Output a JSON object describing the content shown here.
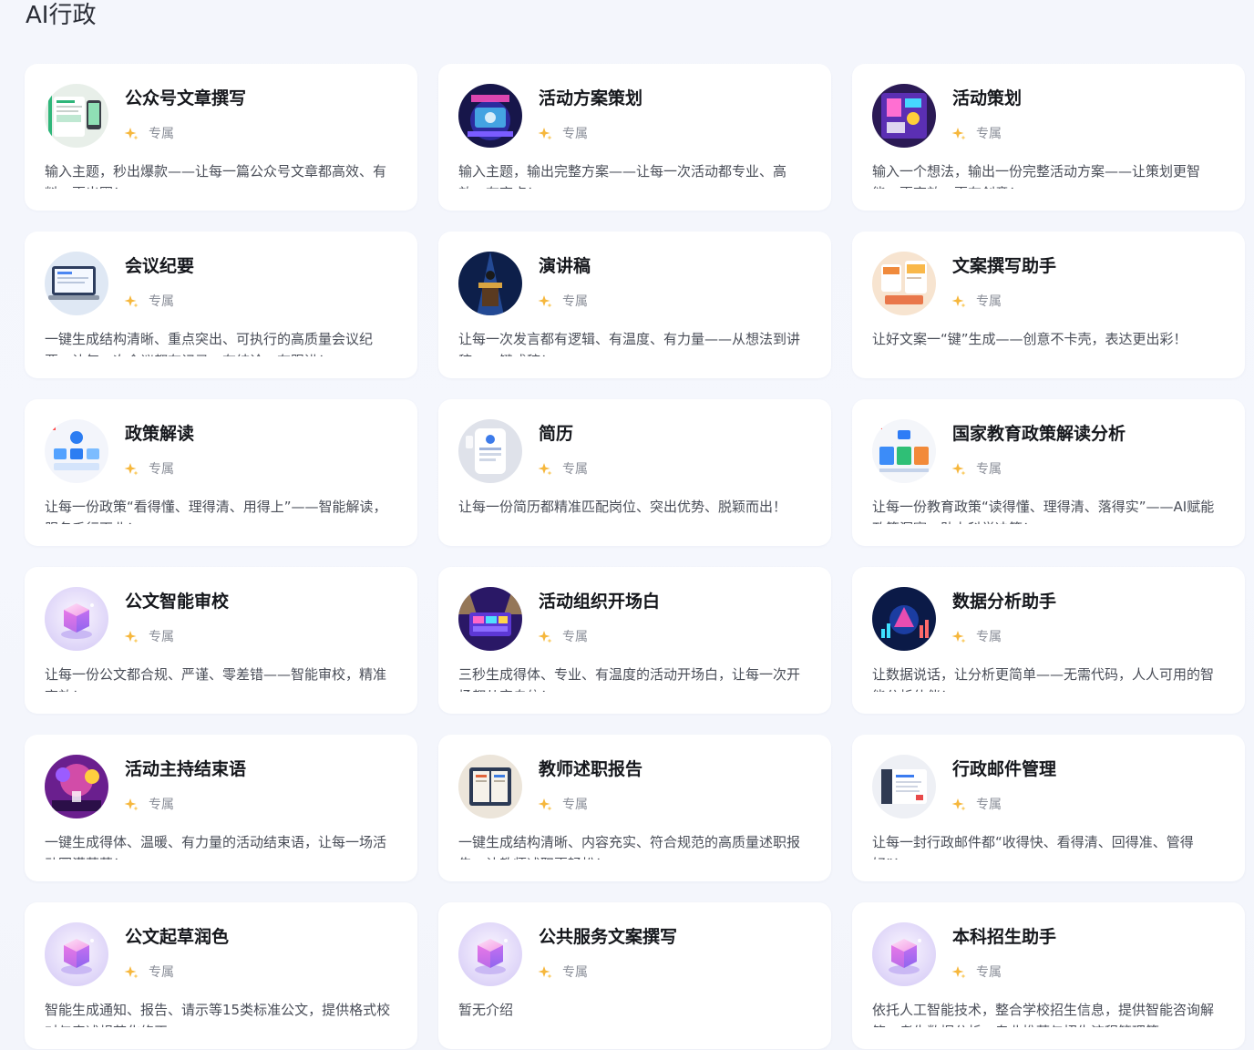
{
  "section": {
    "title": "AI行政"
  },
  "badge_label": "专属",
  "cards": [
    {
      "title": "公众号文章撰写",
      "badge": "专属",
      "desc": "输入主题，秒出爆款——让每一篇公众号文章都高效、有料、更出圈！",
      "icon": "wechat-article-icon"
    },
    {
      "title": "活动方案策划",
      "badge": "专属",
      "desc": "输入主题，输出完整方案——让每一次活动都专业、高效、有亮点！",
      "icon": "event-plan-icon"
    },
    {
      "title": "活动策划",
      "badge": "专属",
      "desc": "输入一个想法，输出一份完整活动方案——让策划更智能、更高效、更有创意！",
      "icon": "event-planning-icon"
    },
    {
      "title": "会议纪要",
      "badge": "专属",
      "desc": "一键生成结构清晰、重点突出、可执行的高质量会议纪要，让每一次会议都有记录、有结论、有跟进！",
      "icon": "meeting-minutes-icon"
    },
    {
      "title": "演讲稿",
      "badge": "专属",
      "desc": "让每一次发言都有逻辑、有温度、有力量——从想法到讲稿，一键成稿！",
      "icon": "speech-icon"
    },
    {
      "title": "文案撰写助手",
      "badge": "专属",
      "desc": "让好文案一“键”生成——创意不卡壳，表达更出彩！",
      "icon": "copywriting-icon"
    },
    {
      "title": "政策解读",
      "badge": "专属",
      "desc": "让每一份政策“看得懂、理得清、用得上”——智能解读，服务千行百业！",
      "icon": "policy-icon"
    },
    {
      "title": "简历",
      "badge": "专属",
      "desc": "让每一份简历都精准匹配岗位、突出优势、脱颖而出！",
      "icon": "resume-icon"
    },
    {
      "title": "国家教育政策解读分析",
      "badge": "专属",
      "desc": "让每一份教育政策“读得懂、理得清、落得实”——AI赋能政策洞察，助力科学决策！",
      "icon": "education-policy-icon"
    },
    {
      "title": "公文智能审校",
      "badge": "专属",
      "desc": "让每一份公文都合规、严谨、零差错——智能审校，精准高效！",
      "icon": "cube-icon"
    },
    {
      "title": "活动组织开场白",
      "badge": "专属",
      "desc": "三秒生成得体、专业、有温度的活动开场白，让每一次开场都从容自信！",
      "icon": "opening-speech-icon"
    },
    {
      "title": "数据分析助手",
      "badge": "专属",
      "desc": "让数据说话，让分析更简单——无需代码，人人可用的智能分析伙伴！",
      "icon": "data-analysis-icon"
    },
    {
      "title": "活动主持结束语",
      "badge": "专属",
      "desc": "一键生成得体、温暖、有力量的活动结束语，让每一场活动圆满落幕！",
      "icon": "closing-speech-icon"
    },
    {
      "title": "教师述职报告",
      "badge": "专属",
      "desc": "一键生成结构清晰、内容充实、符合规范的高质量述职报告，让教师述职更轻松！",
      "icon": "teacher-report-icon"
    },
    {
      "title": "行政邮件管理",
      "badge": "专属",
      "desc": "让每一封行政邮件都“收得快、看得清、回得准、管得好”！",
      "icon": "email-icon"
    },
    {
      "title": "公文起草润色",
      "badge": "专属",
      "desc": "智能生成通知、报告、请示等15类标准公文，提供格式校对与表述规范化修正",
      "icon": "cube-icon"
    },
    {
      "title": "公共服务文案撰写",
      "badge": "专属",
      "desc": "暂无介绍",
      "icon": "cube-icon"
    },
    {
      "title": "本科招生助手",
      "badge": "专属",
      "desc": "依托人工智能技术，整合学校招生信息，提供智能咨询解答、考生数据分析、专业推荐与招生流程管理等",
      "icon": "cube-icon"
    }
  ]
}
